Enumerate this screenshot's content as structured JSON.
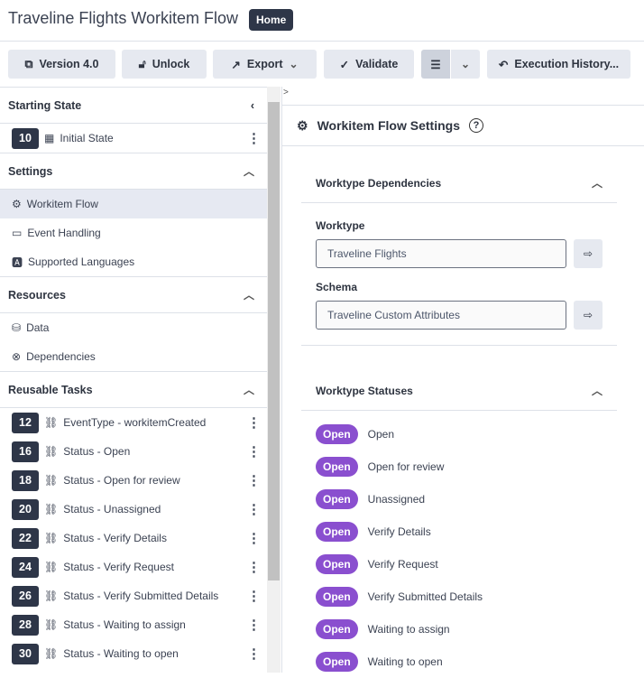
{
  "header": {
    "title": "Traveline Flights Workitem Flow",
    "home_badge": "Home"
  },
  "toolbar": {
    "version": "Version 4.0",
    "unlock": "Unlock",
    "export": "Export",
    "validate": "Validate",
    "execution_history": "Execution History..."
  },
  "sidebar": {
    "starting_state": {
      "title": "Starting State",
      "item": {
        "num": "10",
        "label": "Initial State"
      }
    },
    "settings": {
      "title": "Settings",
      "items": [
        {
          "label": "Workitem Flow"
        },
        {
          "label": "Event Handling"
        },
        {
          "label": "Supported Languages"
        }
      ]
    },
    "resources": {
      "title": "Resources",
      "items": [
        {
          "label": "Data"
        },
        {
          "label": "Dependencies"
        }
      ]
    },
    "reusable": {
      "title": "Reusable Tasks",
      "items": [
        {
          "num": "12",
          "label": "EventType - workitemCreated"
        },
        {
          "num": "16",
          "label": "Status - Open"
        },
        {
          "num": "18",
          "label": "Status - Open for review"
        },
        {
          "num": "20",
          "label": "Status - Unassigned"
        },
        {
          "num": "22",
          "label": "Status - Verify Details"
        },
        {
          "num": "24",
          "label": "Status - Verify Request"
        },
        {
          "num": "26",
          "label": "Status - Verify Submitted Details"
        },
        {
          "num": "28",
          "label": "Status - Waiting to assign"
        },
        {
          "num": "30",
          "label": "Status - Waiting to open"
        }
      ]
    }
  },
  "main": {
    "expand": ">",
    "title": "Workitem Flow Settings",
    "dependencies": {
      "title": "Worktype Dependencies",
      "worktype_label": "Worktype",
      "worktype_value": "Traveline Flights",
      "schema_label": "Schema",
      "schema_value": "Traveline Custom Attributes"
    },
    "statuses": {
      "title": "Worktype Statuses",
      "items": [
        {
          "category": "Open",
          "name": "Open"
        },
        {
          "category": "Open",
          "name": "Open for review"
        },
        {
          "category": "Open",
          "name": "Unassigned"
        },
        {
          "category": "Open",
          "name": "Verify Details"
        },
        {
          "category": "Open",
          "name": "Verify Request"
        },
        {
          "category": "Open",
          "name": "Verify Submitted Details"
        },
        {
          "category": "Open",
          "name": "Waiting to assign"
        },
        {
          "category": "Open",
          "name": "Waiting to open"
        }
      ]
    }
  },
  "colors": {
    "status_pill": "#8a4fcf",
    "badge_dark": "#2e3648"
  }
}
